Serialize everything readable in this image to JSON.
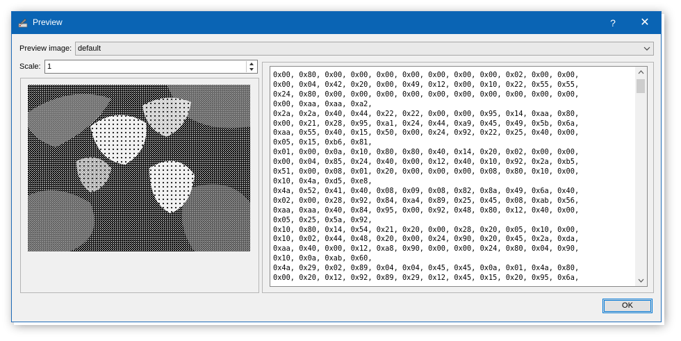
{
  "window": {
    "title": "Preview",
    "help_label": "?",
    "close_label": "✕"
  },
  "preview_image": {
    "label": "Preview image:",
    "selected": "default"
  },
  "scale": {
    "label": "Scale:",
    "value": "1"
  },
  "hex_output": {
    "text": "0x00, 0x80, 0x00, 0x00, 0x00, 0x00, 0x00, 0x00, 0x00, 0x02, 0x00, 0x00,\n0x00, 0x04, 0x42, 0x20, 0x00, 0x49, 0x12, 0x00, 0x10, 0x22, 0x55, 0x55,\n0x24, 0x80, 0x00, 0x00, 0x00, 0x00, 0x00, 0x00, 0x00, 0x00, 0x00, 0x00,\n0x00, 0xaa, 0xaa, 0xa2,\n0x2a, 0x2a, 0x40, 0x44, 0x22, 0x22, 0x00, 0x00, 0x95, 0x14, 0xaa, 0x80,\n0x00, 0x21, 0x28, 0x95, 0xa1, 0x24, 0x44, 0xa9, 0x45, 0x49, 0x5b, 0x6a,\n0xaa, 0x55, 0x40, 0x15, 0x50, 0x00, 0x24, 0x92, 0x22, 0x25, 0x40, 0x00,\n0x05, 0x15, 0xb6, 0x81,\n0x01, 0x00, 0x0a, 0x10, 0x80, 0x80, 0x40, 0x14, 0x20, 0x02, 0x00, 0x00,\n0x00, 0x04, 0x85, 0x24, 0x40, 0x00, 0x12, 0x40, 0x10, 0x92, 0x2a, 0xb5,\n0x51, 0x00, 0x08, 0x01, 0x20, 0x00, 0x00, 0x00, 0x08, 0x80, 0x10, 0x00,\n0x10, 0x4a, 0xd5, 0xe8,\n0x4a, 0x52, 0x41, 0x40, 0x08, 0x09, 0x08, 0x82, 0x8a, 0x49, 0x6a, 0x40,\n0x02, 0x00, 0x28, 0x92, 0x84, 0xa4, 0x89, 0x25, 0x45, 0x08, 0xab, 0x56,\n0xaa, 0xaa, 0x40, 0x84, 0x95, 0x00, 0x92, 0x48, 0x80, 0x12, 0x40, 0x00,\n0x05, 0x25, 0x5a, 0x92,\n0x10, 0x80, 0x14, 0x54, 0x21, 0x20, 0x00, 0x28, 0x20, 0x05, 0x10, 0x00,\n0x10, 0x02, 0x44, 0x48, 0x20, 0x00, 0x24, 0x90, 0x20, 0x45, 0x2a, 0xda,\n0xaa, 0x40, 0x00, 0x12, 0xa8, 0x90, 0x00, 0x00, 0x24, 0x80, 0x04, 0x90,\n0x10, 0x0a, 0xab, 0x60,\n0x4a, 0x29, 0x02, 0x89, 0x04, 0x04, 0x45, 0x45, 0x0a, 0x01, 0x4a, 0x80,\n0x00, 0x20, 0x12, 0x92, 0x89, 0x29, 0x12, 0x45, 0x15, 0x20, 0x95, 0x6a,"
  },
  "ok_button": {
    "label": "OK"
  }
}
